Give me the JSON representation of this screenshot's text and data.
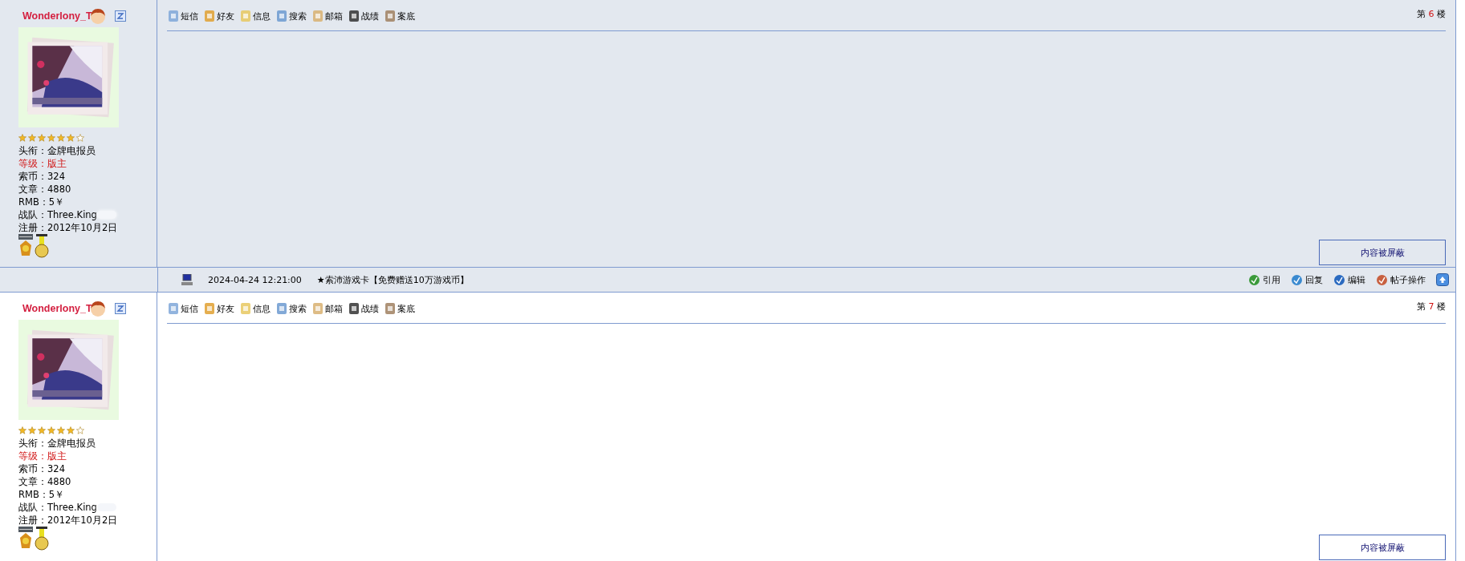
{
  "posts": [
    {
      "username": "Wonderlony_T",
      "stars": 6,
      "profile": [
        {
          "label": "头衔：",
          "value": "金牌电报员",
          "highlight": false
        },
        {
          "label": "等级：",
          "value": "版主",
          "highlight": true
        },
        {
          "label": "索币：",
          "value": "324",
          "highlight": false
        },
        {
          "label": "文章：",
          "value": "4880",
          "highlight": false
        },
        {
          "label": "RMB：",
          "value": "5￥",
          "highlight": false
        },
        {
          "label": "战队：",
          "value": "Three.King",
          "highlight": false,
          "blurred": true
        },
        {
          "label": "注册：",
          "value": "2012年10月2日",
          "highlight": false
        }
      ],
      "toolbar": [
        "短信",
        "好友",
        "信息",
        "搜索",
        "邮箱",
        "战绩",
        "案底"
      ],
      "floor_prefix": "第",
      "floor": "6",
      "floor_suffix": "楼",
      "notice": "内容被屏蔽",
      "shaded": true,
      "footer": {
        "time": "2024-04-24 12:21:00",
        "ad": "★索沛游戏卡【免费赠送10万游戏币】",
        "actions": [
          "引用",
          "回复",
          "编辑",
          "帖子操作"
        ]
      }
    },
    {
      "username": "Wonderlony_T",
      "stars": 6,
      "profile": [
        {
          "label": "头衔：",
          "value": "金牌电报员",
          "highlight": false
        },
        {
          "label": "等级：",
          "value": "版主",
          "highlight": true
        },
        {
          "label": "索币：",
          "value": "324",
          "highlight": false
        },
        {
          "label": "文章：",
          "value": "4880",
          "highlight": false
        },
        {
          "label": "RMB：",
          "value": "5￥",
          "highlight": false
        },
        {
          "label": "战队：",
          "value": "Three.King",
          "highlight": false,
          "blurred": true
        },
        {
          "label": "注册：",
          "value": "2012年10月2日",
          "highlight": false
        }
      ],
      "toolbar": [
        "短信",
        "好友",
        "信息",
        "搜索",
        "邮箱",
        "战绩",
        "案底"
      ],
      "floor_prefix": "第",
      "floor": "7",
      "floor_suffix": "楼",
      "notice": "内容被屏蔽",
      "shaded": false
    }
  ]
}
